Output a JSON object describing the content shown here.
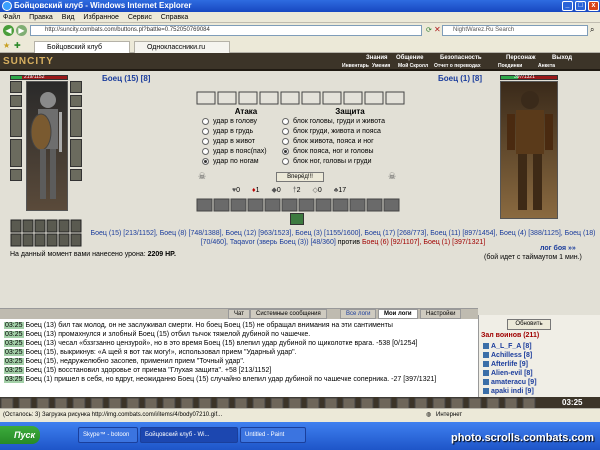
{
  "window": {
    "title": "Бойцовский клуб - Windows Internet Explorer"
  },
  "menu": [
    "Файл",
    "Правка",
    "Вид",
    "Избранное",
    "Сервис",
    "Справка"
  ],
  "address": {
    "url": "http://suncity.combats.com/buttons.pl?battle=0.752050769084",
    "search_placeholder": "NightWarez.Ru Search"
  },
  "tabs": [
    {
      "label": "Бойцовский клуб"
    },
    {
      "label": "Одноклассники.ru"
    }
  ],
  "game": {
    "logo": "SUNCITY",
    "nav_top": [
      "Знания",
      "Общение",
      "Безопасность",
      "Персонаж",
      "Выход"
    ],
    "nav_bottom": [
      "Инвентарь",
      "Умения",
      "Мой Скролл",
      "Отчет о переводах",
      "Поединки",
      "Анкета"
    ],
    "left_hp": "219/1152",
    "left_hp_pct": 0.19,
    "right_hp": "397/1321",
    "right_hp_pct": 0.3,
    "left_fighter": "Боец (15) [8]",
    "right_fighter": "Боец (1) [8]",
    "attack_title": "Атака",
    "defense_title": "Защита",
    "attack_options": [
      "удар в голову",
      "удар в грудь",
      "удар в живот",
      "удар в пояс(пах)",
      "удар по ногам"
    ],
    "attack_selected": 4,
    "defense_options": [
      "блок головы, груди и живота",
      "блок груди, живота и пояса",
      "блок живота, пояса и ног",
      "блок пояса, ног и головы",
      "блок ног, головы и груди"
    ],
    "defense_selected": 3,
    "forward_btn": "Вперёд!!!",
    "stats": [
      "0",
      "1",
      "0",
      "2",
      "0",
      "17"
    ],
    "participants_text": "Боец (15) [213/1152], Боец (8) [748/1388], Боец (12) [963/1523], Боец (3) [1155/1600], Боец (17) [268/773], Боец (11) [897/1454], Боец (4) [388/1125], Боец (18) [70/460], Taqavor (зверь Боец (3)) [48/360]",
    "vs": "против",
    "opponents_text": "Боец (6) [92/1107], Боец (1) [397/1321]",
    "damage_label": "На данный момент вами нанесено урона:",
    "damage_value": "2209 HP.",
    "log_link": "лог боя »»",
    "timeout": "(бой идет с таймаутом 1 мин.)"
  },
  "chat": {
    "tabs": [
      "Чат",
      "Системные сообщения",
      "Все логи",
      "Мои логи",
      "Настройки"
    ],
    "active_tab": 3,
    "lines": [
      {
        "ts": "03:25",
        "text": "Боец (13) бил так молод, он не заслуживал смерти. Но боец Боец (15) не обращал внимания на эти сантименты"
      },
      {
        "ts": "03:25",
        "text": "Боец (13) промахнулся и злобный Боец (15) отбил тычок тяжелой дубиной по чашечке."
      },
      {
        "ts": "03:25",
        "text": "Боец (13) чесал «бззгзанно цензурой», но в это время Боец (15) влепил удар дубиной по щиколотке врага. -538 [0/1254]"
      },
      {
        "ts": "03:25",
        "text": "Боец (15), выкрикнув: «А щей я вот так могу!», использовал прием \"Ударный удар\"."
      },
      {
        "ts": "03:25",
        "text": "Боец (15), недружелюбно засопев, применил прием \"Точный удар\"."
      },
      {
        "ts": "03:25",
        "text": "Боец (15) восстановил здоровье от приема \"Глухая защита\". +58 [213/1152]"
      },
      {
        "ts": "03:25",
        "text": "Боец (1) пришел в себя, но вдруг, неожиданно Боец (15) случайно влепил удар дубиной по чашечке соперника. -27 [397/1321]"
      }
    ]
  },
  "roster": {
    "refresh_btn": "Обновить",
    "title": "Зал воинов (211)",
    "players": [
      "A_L_F_A [8]",
      "Achilless [8]",
      "Afterlife [9]",
      "Alien-evil [8]",
      "amateracu [9]",
      "apaki indi [9]"
    ]
  },
  "chat_input_time": "03:25",
  "status": {
    "text": "(Осталось: 3) Загрузка рисунка http://img.combats.com/i/items/4/body07210.gif...",
    "zone": "Интернет"
  },
  "taskbar": {
    "start": "Пуск",
    "buttons": [
      "Skype™ - botoon",
      "Бойцовский клуб - Wi...",
      "Untitled - Paint"
    ]
  },
  "watermark": "photo.scrolls.combats.com"
}
